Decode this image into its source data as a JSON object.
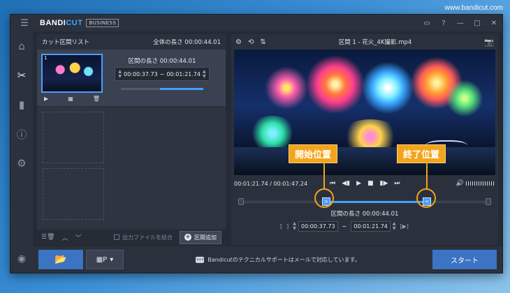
{
  "watermark": "www.bandicut.com",
  "app": {
    "brand_main": "BANDI",
    "brand_accent": "CUT",
    "edition_badge": "BUSINESS"
  },
  "clip_list": {
    "title": "カット区間リスト",
    "total_length": "全体の長さ 00:00:44.01",
    "clip": {
      "number": "1",
      "length_label": "区間の長さ 00:00:44.01",
      "start": "00:00:37.73",
      "separator": "~",
      "end": "00:01:21.74"
    },
    "merge_label": "出力ファイルを結合",
    "add_button": "区間追加"
  },
  "preview": {
    "title": "区間 1 - 花火_4K撮影.mp4",
    "current_time": "00:01:21.74 / 00:01:47.24",
    "selection_length": "区間の長さ 00:00:44.01",
    "start": "00:00:37.73",
    "separator": "~",
    "end": "00:01:21.74",
    "start_marker_progress": 0.35,
    "end_marker_progress": 0.76
  },
  "callouts": {
    "start": "開始位置",
    "end": "終了位置"
  },
  "footer": {
    "support_text": "Bandicutのテクニカルサポートはメールで対応しています。",
    "start_button": "スタート"
  },
  "colors": {
    "accent_blue": "#3c73c2",
    "highlight": "#4a9dff",
    "callout": "#f4a41a"
  }
}
